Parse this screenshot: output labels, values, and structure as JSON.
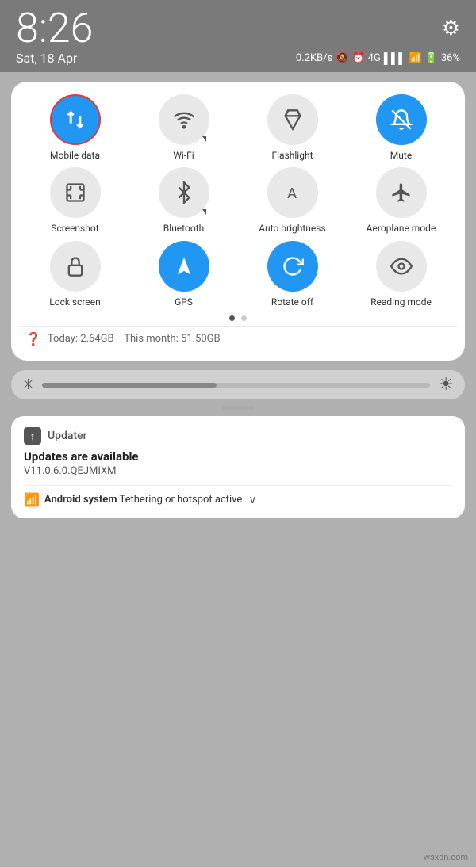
{
  "statusBar": {
    "time": "8:26",
    "date": "Sat, 18 Apr",
    "speed": "0.2KB/s",
    "battery": "36%"
  },
  "quickSettings": {
    "toggles": [
      {
        "id": "mobile-data",
        "label": "Mobile data",
        "active": true,
        "selected": true,
        "icon": "arrows-updown"
      },
      {
        "id": "wifi",
        "label": "Wi-Fi",
        "active": false,
        "icon": "wifi",
        "hasArrow": true
      },
      {
        "id": "flashlight",
        "label": "Flashlight",
        "active": false,
        "icon": "flashlight"
      },
      {
        "id": "mute",
        "label": "Mute",
        "active": true,
        "icon": "bell-mute"
      },
      {
        "id": "screenshot",
        "label": "Screenshot",
        "active": false,
        "icon": "screenshot"
      },
      {
        "id": "bluetooth",
        "label": "Bluetooth",
        "active": false,
        "icon": "bluetooth",
        "hasArrow": true
      },
      {
        "id": "auto-brightness",
        "label": "Auto brightness",
        "active": false,
        "icon": "brightness-a"
      },
      {
        "id": "aeroplane",
        "label": "Aeroplane mode",
        "active": false,
        "icon": "airplane"
      },
      {
        "id": "lock-screen",
        "label": "Lock screen",
        "active": false,
        "icon": "lock"
      },
      {
        "id": "gps",
        "label": "GPS",
        "active": true,
        "icon": "gps"
      },
      {
        "id": "rotate-off",
        "label": "Rotate off",
        "active": true,
        "icon": "rotate"
      },
      {
        "id": "reading-mode",
        "label": "Reading mode",
        "active": false,
        "icon": "eye"
      }
    ],
    "dots": [
      true,
      false
    ],
    "dataUsage": {
      "today": "Today: 2.64GB",
      "thisMonth": "This month: 51.50GB"
    }
  },
  "notifications": [
    {
      "appIcon": "↑",
      "appName": "Updater",
      "title": "Updates are available",
      "body": "V11.0.6.0.QEJMIXM"
    },
    {
      "icon": "wifi",
      "boldText": "Android system",
      "text": "Tethering or hotspot active",
      "hasChevron": true
    }
  ],
  "watermark": "wsxdn.com"
}
